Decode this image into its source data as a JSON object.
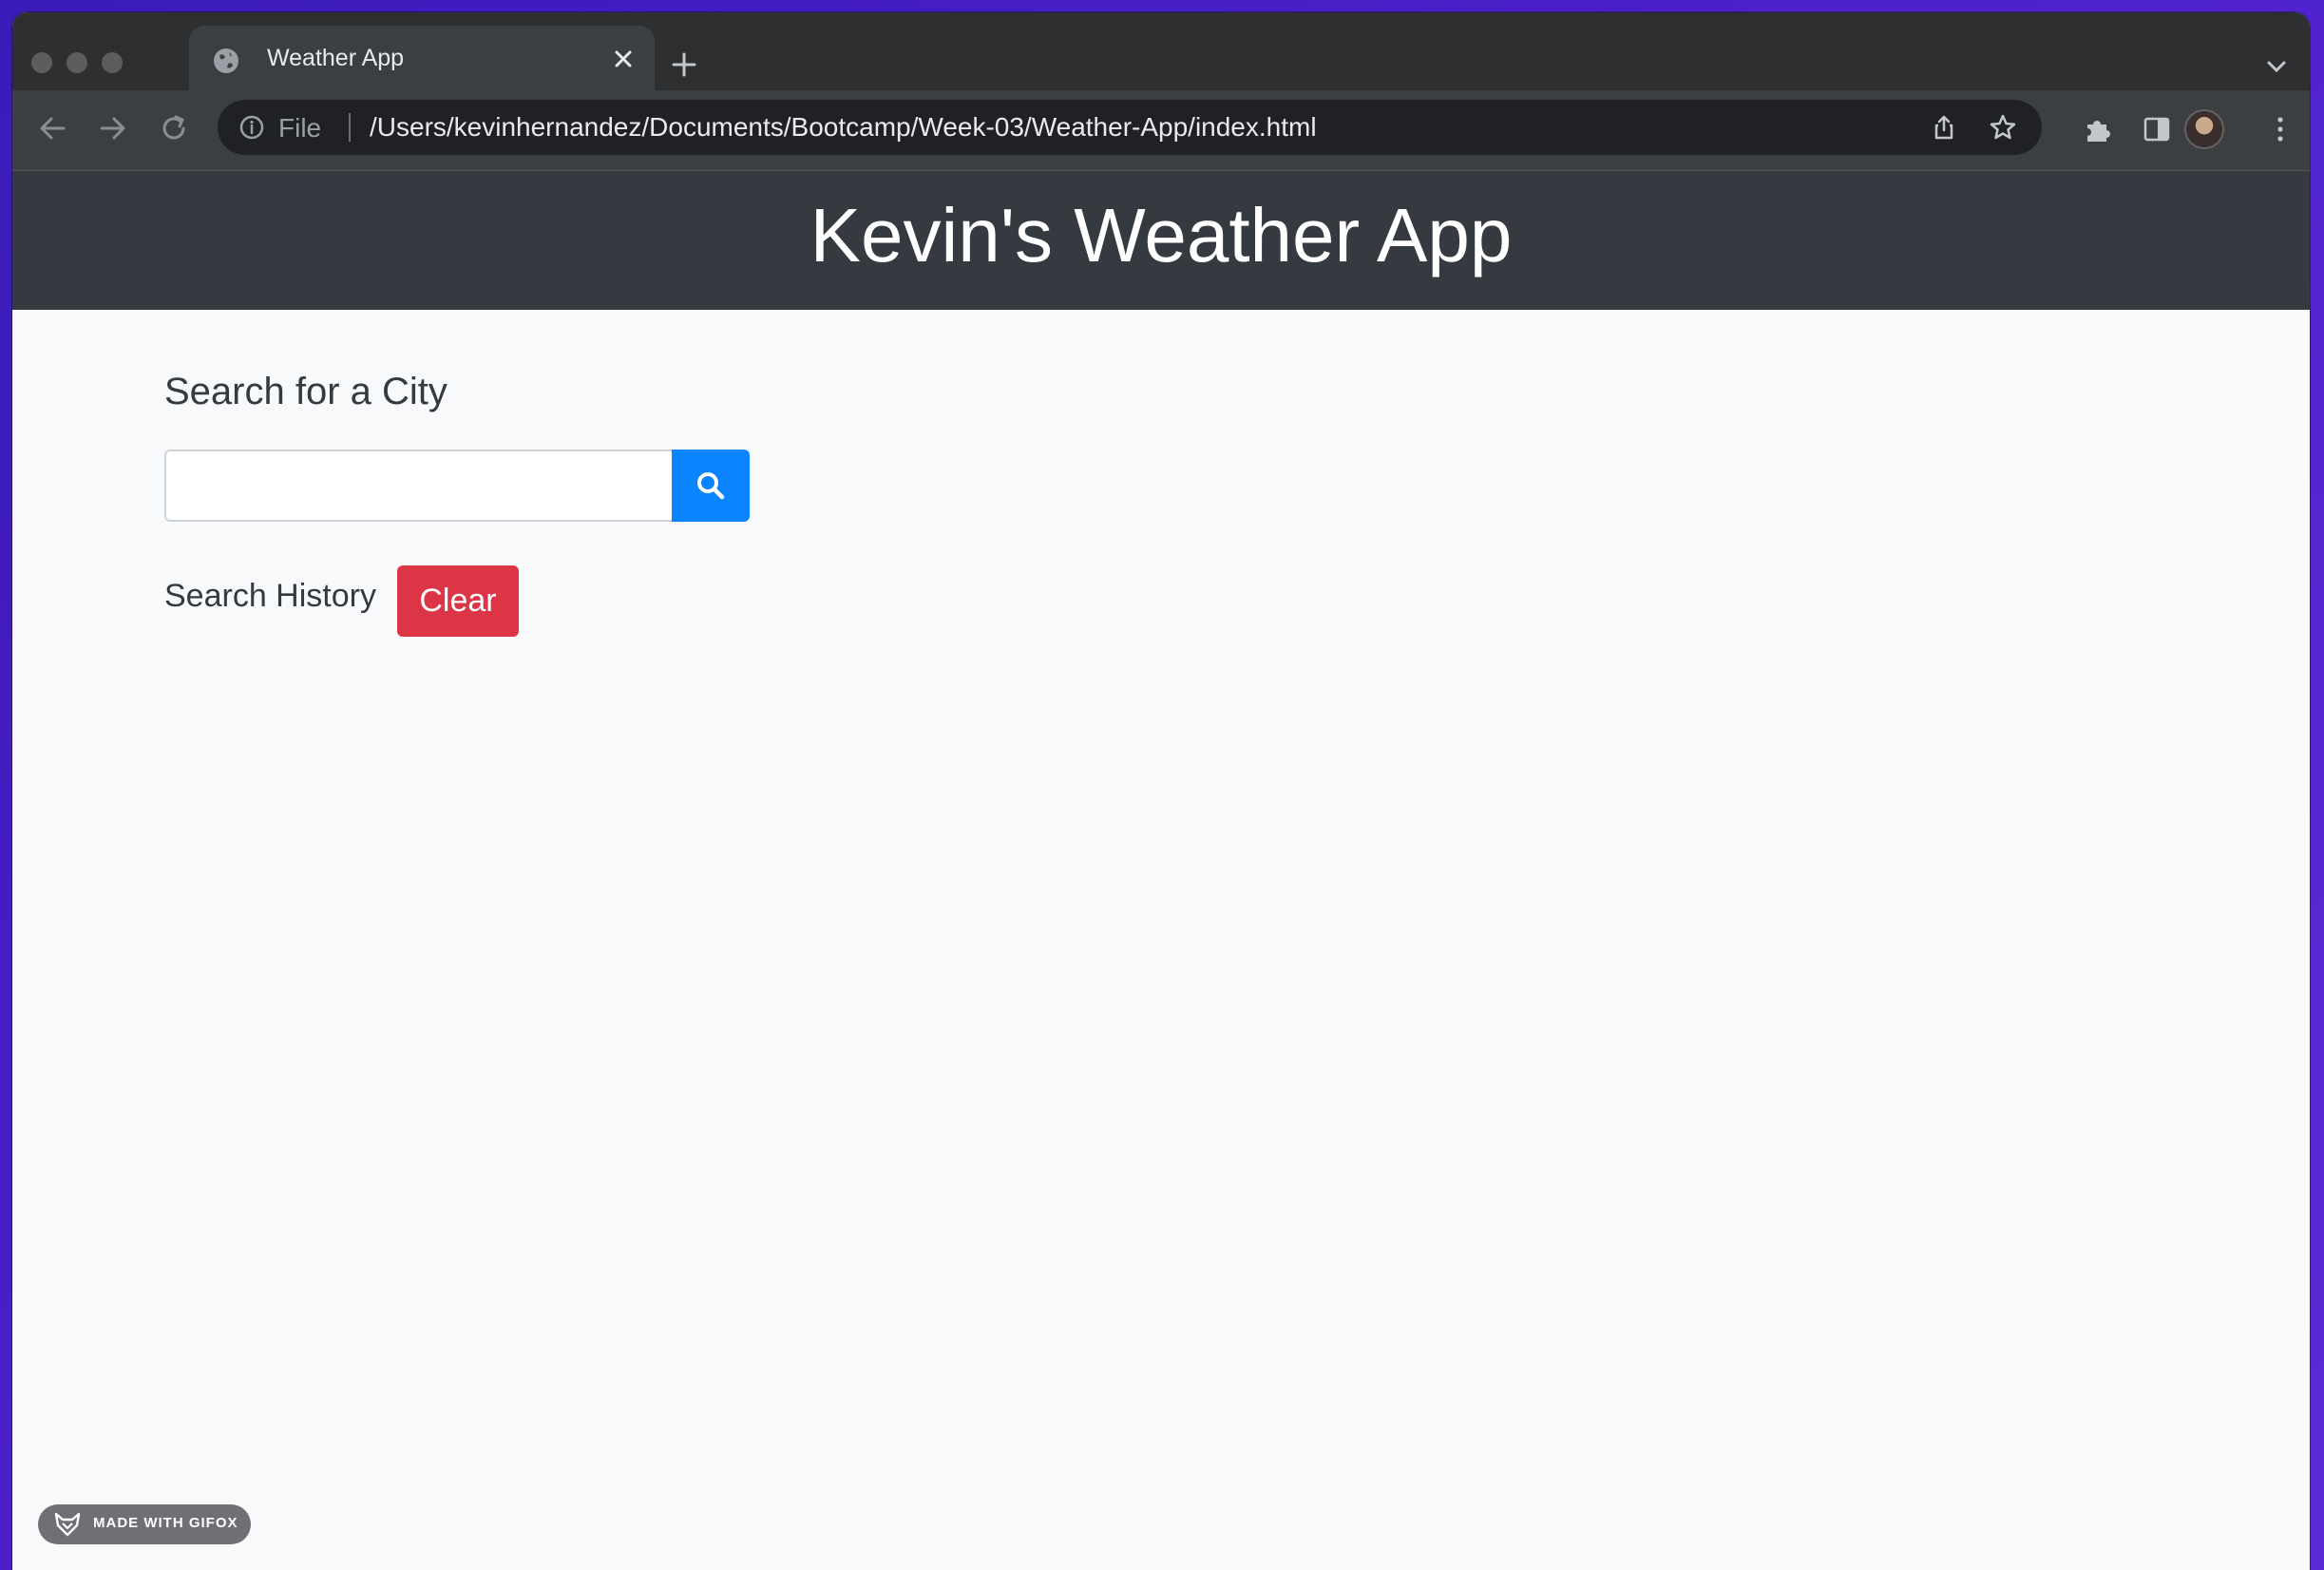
{
  "browser": {
    "tab_title": "Weather App",
    "url_scheme_label": "File",
    "url": "/Users/kevinhernandez/Documents/Bootcamp/Week-03/Weather-App/index.html"
  },
  "header": {
    "title": "Kevin's Weather App"
  },
  "search": {
    "heading": "Search for a City",
    "input_value": "",
    "placeholder": ""
  },
  "history": {
    "label": "Search History",
    "clear_label": "Clear"
  },
  "badge": {
    "text": "MADE WITH GIFOX"
  },
  "colors": {
    "header_bg": "#343a40",
    "search_button": "#0a84ff",
    "clear_button": "#dc3545"
  },
  "icons": [
    "globe-icon",
    "close-icon",
    "plus-icon",
    "back-icon",
    "forward-icon",
    "reload-icon",
    "info-icon",
    "share-icon",
    "star-icon",
    "extensions-icon",
    "side-panel-icon",
    "more-icon",
    "search-icon",
    "fox-icon"
  ]
}
